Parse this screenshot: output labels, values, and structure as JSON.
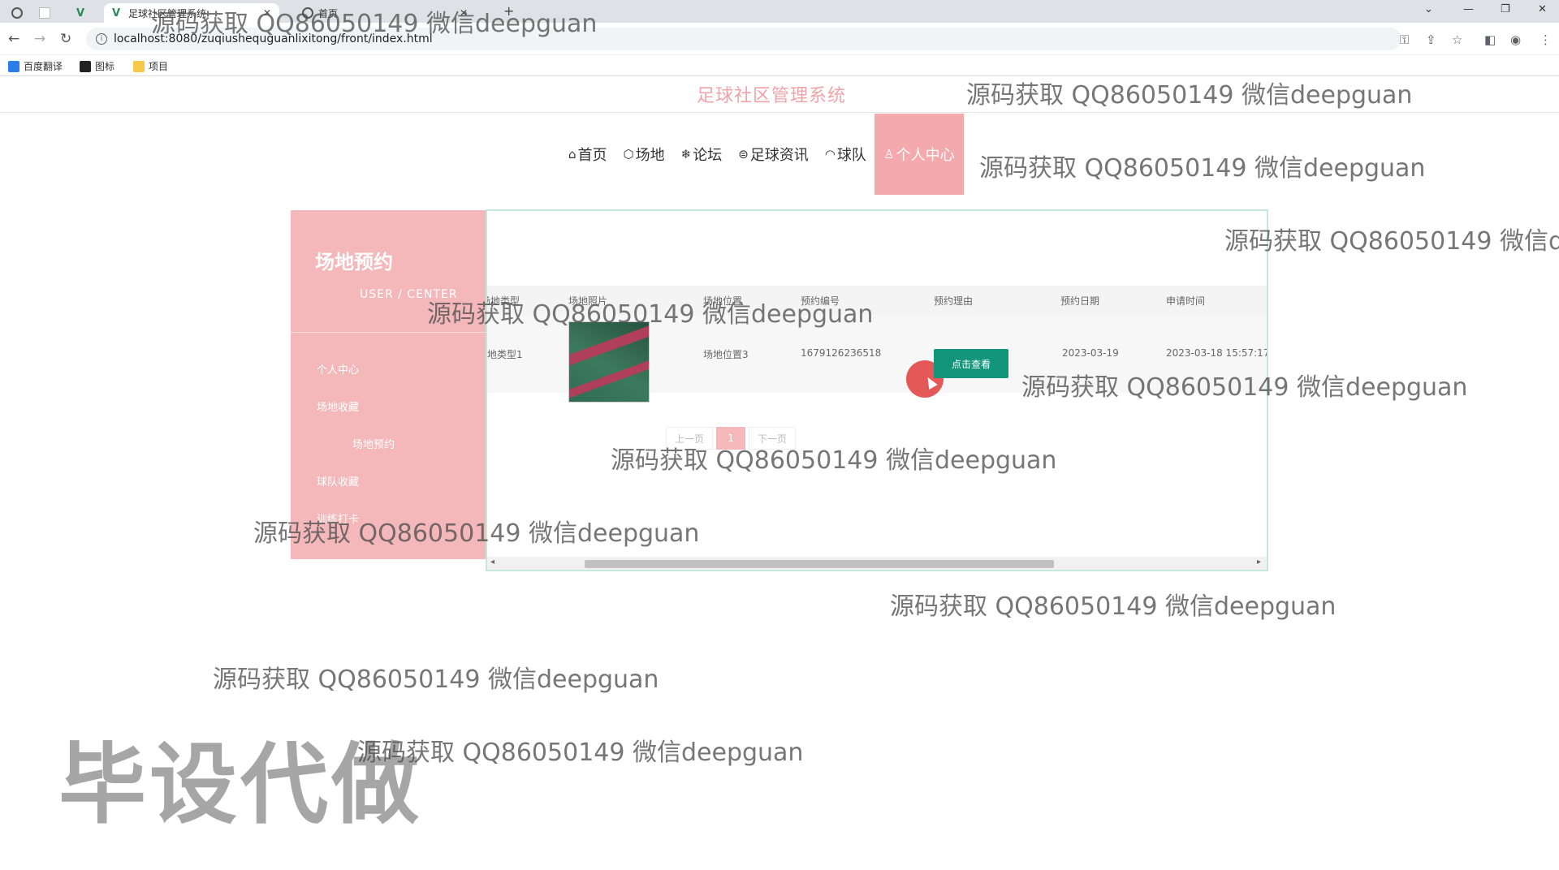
{
  "browser": {
    "tabs": [
      {
        "label": ""
      },
      {
        "label": ""
      },
      {
        "label": ""
      },
      {
        "label": "足球社区管理系统"
      },
      {
        "label": "首页"
      }
    ],
    "url": "localhost:8080/zuqiushequguanlixitong/front/index.html",
    "bookmarks": [
      "百度翻译",
      "图标",
      "项目"
    ]
  },
  "site": {
    "title": "足球社区管理系统",
    "nav": [
      {
        "icon": "⌂",
        "label": "首页"
      },
      {
        "icon": "⬡",
        "label": "场地"
      },
      {
        "icon": "❄",
        "label": "论坛"
      },
      {
        "icon": "⊜",
        "label": "足球资讯"
      },
      {
        "icon": "◠",
        "label": "球队"
      },
      {
        "icon": "♙",
        "label": "个人中心"
      }
    ]
  },
  "sidebar": {
    "title": "场地预约",
    "subtitle": "USER / CENTER",
    "items": [
      "个人中心",
      "场地收藏",
      "场地预约",
      "球队收藏",
      "训练打卡"
    ]
  },
  "table": {
    "headers": [
      "场地类型",
      "场地照片",
      "场地位置",
      "预约编号",
      "预约理由",
      "预约日期",
      "申请时间"
    ],
    "rows": [
      {
        "type": "地类型1",
        "location": "场地位置3",
        "number": "1679126236518",
        "reason_button": "点击查看",
        "date": "2023-03-19",
        "applied": "2023-03-18 15:57:17"
      }
    ]
  },
  "pager": {
    "prev": "上一页",
    "current": "1",
    "next": "下一页"
  },
  "watermarks": {
    "text": "源码获取 QQ86050149 微信deepguan",
    "truncated": "源码获取 QQ86050149 微信d",
    "big": "毕设代做"
  },
  "colors": {
    "accent_pink": "#f4b8bb",
    "nav_active": "#f4a9ad",
    "button_green": "#12957b",
    "box_border": "#c5e8d7"
  }
}
